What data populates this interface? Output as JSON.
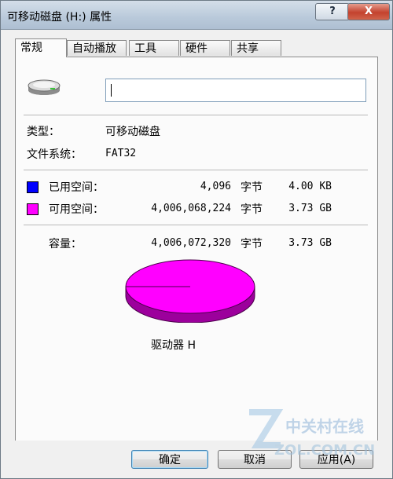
{
  "window": {
    "title": "可移动磁盘 (H:) 属性",
    "help_label": "?",
    "close_label": "X"
  },
  "tabs": [
    {
      "label": "常规",
      "active": true
    },
    {
      "label": "自动播放",
      "active": false
    },
    {
      "label": "工具",
      "active": false
    },
    {
      "label": "硬件",
      "active": false
    },
    {
      "label": "共享",
      "active": false
    }
  ],
  "general": {
    "drive_icon": "removable-drive-icon",
    "volume_name_value": "",
    "type_label": "类型：",
    "type_value": "可移动磁盘",
    "fs_label": "文件系统：",
    "fs_value": "FAT32"
  },
  "usage": {
    "used": {
      "label": "已用空间：",
      "bytes": "4,096",
      "unit": "字节",
      "size": "4.00 KB",
      "color": "#0000ff"
    },
    "free": {
      "label": "可用空间：",
      "bytes": "4,006,068,224",
      "unit": "字节",
      "size": "3.73 GB",
      "color": "#ff00ff"
    },
    "capacity": {
      "label": "容量：",
      "bytes": "4,006,072,320",
      "unit": "字节",
      "size": "3.73 GB"
    }
  },
  "pie": {
    "used_fraction": 1e-06,
    "free_color": "#ff00ff",
    "side_color": "#9c009c",
    "drive_label": "驱动器 H"
  },
  "buttons": {
    "ok": "确定",
    "cancel": "取消",
    "apply": "应用(A)"
  },
  "watermark": {
    "brand": "中关村在线",
    "url": "ZOL.COM.CN"
  }
}
